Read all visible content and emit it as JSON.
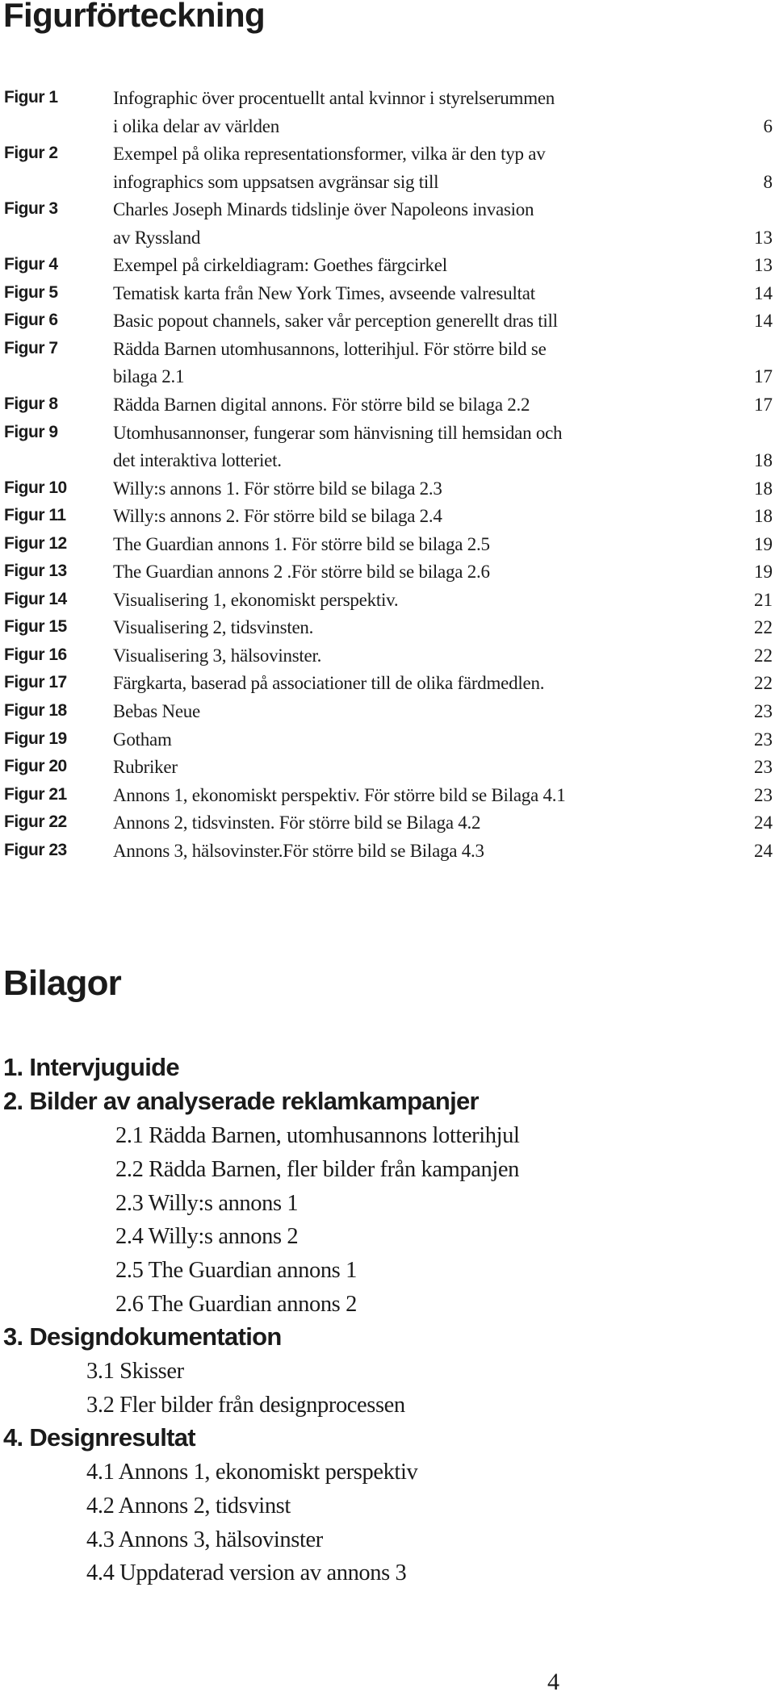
{
  "figures": {
    "title": "Figurförteckning",
    "entries": [
      {
        "label": "Figur 1",
        "lines": [
          "Infographic över procentuellt antal kvinnor i styrelserummen",
          "i olika delar av världen"
        ],
        "page": "6"
      },
      {
        "label": "Figur 2",
        "lines": [
          "Exempel på olika representationsformer, vilka är den typ av",
          "infographics som uppsatsen avgränsar sig till"
        ],
        "page": "8"
      },
      {
        "label": "Figur 3",
        "lines": [
          "Charles Joseph Minards tidslinje över Napoleons invasion",
          "av Ryssland"
        ],
        "page": "13"
      },
      {
        "label": "Figur 4",
        "lines": [
          "Exempel på cirkeldiagram: Goethes färgcirkel"
        ],
        "page": "13"
      },
      {
        "label": "Figur 5",
        "lines": [
          "Tematisk karta från New York Times, avseende valresultat"
        ],
        "page": "14"
      },
      {
        "label": "Figur 6",
        "lines": [
          "Basic popout channels, saker vår perception generellt dras till"
        ],
        "page": "14"
      },
      {
        "label": "Figur 7",
        "lines": [
          "Rädda Barnen utomhusannons, lotterihjul. För större bild se",
          "bilaga 2.1"
        ],
        "page": "17"
      },
      {
        "label": "Figur 8",
        "lines": [
          "Rädda Barnen digital annons. För större bild se bilaga 2.2"
        ],
        "page": "17"
      },
      {
        "label": "Figur 9",
        "lines": [
          "Utomhusannonser, fungerar som hänvisning till hemsidan och",
          "det interaktiva lotteriet."
        ],
        "page": "18"
      },
      {
        "label": "Figur 10",
        "lines": [
          "Willy:s annons 1. För större bild se bilaga 2.3"
        ],
        "page": "18"
      },
      {
        "label": "Figur 11",
        "lines": [
          "Willy:s annons 2. För större bild se bilaga 2.4"
        ],
        "page": "18"
      },
      {
        "label": "Figur 12",
        "lines": [
          "The Guardian annons 1. För större bild se bilaga 2.5"
        ],
        "page": "19"
      },
      {
        "label": "Figur 13",
        "lines": [
          "The Guardian annons 2 .För större bild se bilaga 2.6"
        ],
        "page": "19"
      },
      {
        "label": "Figur 14",
        "lines": [
          "Visualisering 1, ekonomiskt perspektiv."
        ],
        "page": "21"
      },
      {
        "label": "Figur 15",
        "lines": [
          "Visualisering 2, tidsvinsten."
        ],
        "page": "22"
      },
      {
        "label": "Figur 16",
        "lines": [
          "Visualisering 3, hälsovinster."
        ],
        "page": "22"
      },
      {
        "label": "Figur 17",
        "lines": [
          "Färgkarta, baserad på associationer till de olika färdmedlen."
        ],
        "page": "22"
      },
      {
        "label": "Figur 18",
        "lines": [
          "Bebas Neue"
        ],
        "page": "23"
      },
      {
        "label": "Figur 19",
        "lines": [
          "Gotham"
        ],
        "page": "23"
      },
      {
        "label": "Figur 20",
        "lines": [
          "Rubriker"
        ],
        "page": "23"
      },
      {
        "label": "Figur 21",
        "lines": [
          "Annons 1, ekonomiskt perspektiv. För större bild se Bilaga 4.1"
        ],
        "page": "23"
      },
      {
        "label": "Figur 22",
        "lines": [
          "Annons 2, tidsvinsten. För större bild se Bilaga 4.2"
        ],
        "page": "24"
      },
      {
        "label": "Figur 23",
        "lines": [
          "Annons 3, hälsovinster.För större bild se Bilaga 4.3"
        ],
        "page": "24"
      }
    ]
  },
  "appendices": {
    "title": "Bilagor",
    "sections": [
      {
        "label": "1. Intervjuguide",
        "indent": "wide",
        "items": []
      },
      {
        "label": "2. Bilder av analyserade reklamkampanjer",
        "indent": "wide",
        "items": [
          "2.1 Rädda Barnen, utomhusannons lotterihjul",
          "2.2 Rädda Barnen, fler bilder från kampanjen",
          "2.3 Willy:s annons 1",
          "2.4 Willy:s annons 2",
          "2.5 The Guardian annons 1",
          "2.6 The Guardian annons 2"
        ]
      },
      {
        "label": "3. Designdokumentation",
        "indent": "narrow",
        "items": [
          "3.1 Skisser",
          "3.2 Fler bilder från designprocessen"
        ]
      },
      {
        "label": "4. Designresultat",
        "indent": "narrow",
        "items": [
          "4.1 Annons 1, ekonomiskt perspektiv",
          "4.2 Annons 2, tidsvinst",
          "4.3 Annons 3, hälsovinster",
          "4.4 Uppdaterad version av annons 3"
        ]
      }
    ]
  },
  "page_number": "4"
}
